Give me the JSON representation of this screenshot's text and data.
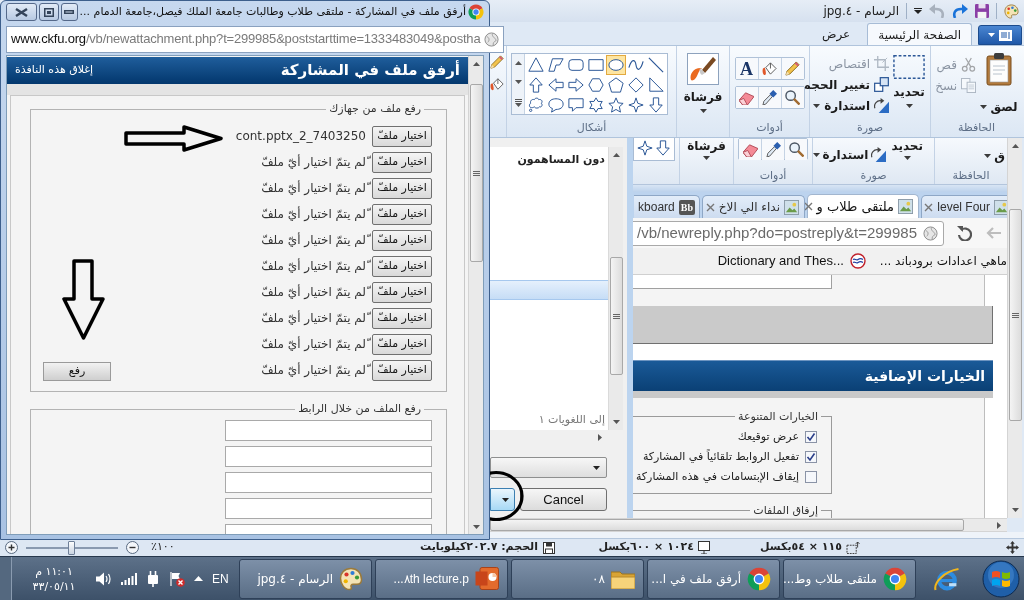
{
  "paint": {
    "title": "الرسام - ٤.jpg",
    "tabs": [
      {
        "label": "الصفحة الرئيسية",
        "selected": true
      },
      {
        "label": "عرض",
        "selected": false
      }
    ],
    "ribbon": {
      "clipboard": {
        "label": "الحافظة",
        "paste": "لصق",
        "commands": [
          {
            "label": "قص",
            "disabled": true
          },
          {
            "label": "نسخ",
            "disabled": true
          }
        ]
      },
      "image": {
        "label": "صورة",
        "select": "تحديد",
        "commands": [
          {
            "label": "اقتصاص",
            "disabled": true
          },
          {
            "label": "تغيير الحجم",
            "disabled": false
          },
          {
            "label": "استدارة",
            "disabled": false
          }
        ]
      },
      "tools": {
        "label": "أدوات",
        "text_tool": "A"
      },
      "brushes": {
        "button": "فرشاة"
      },
      "shapes": {
        "label": "أشكال",
        "items": [
          {
            "selected": false
          },
          {
            "selected": false
          },
          {
            "selected": true
          },
          {
            "selected": false
          },
          {
            "selected": false
          },
          {
            "selected": false
          },
          {
            "selected": false
          },
          {
            "selected": false
          },
          {
            "selected": false
          },
          {
            "selected": false
          },
          {
            "selected": false
          },
          {
            "selected": false
          },
          {
            "selected": false
          },
          {
            "selected": false
          },
          {
            "selected": false
          },
          {
            "selected": false
          },
          {
            "selected": false
          },
          {
            "selected": false
          },
          {
            "selected": false
          },
          {
            "selected": false
          },
          {
            "selected": false
          }
        ]
      }
    },
    "canvas": {
      "list": [
        {
          "text": "دون المساهمون",
          "selected": false,
          "dimmed": false
        },
        {
          "selected": true,
          "dimmed": false
        },
        {
          "text": "إلى اللغويات ١",
          "selected": false,
          "dimmed": true
        }
      ],
      "cancel_button": "Cancel",
      "browser": {
        "ribbon": {
          "paste": "ق",
          "clipboard_label": "الحافظة",
          "select": "تحديد",
          "rotate": "استدارة",
          "image_label": "صورة",
          "tools_label": "أدوات",
          "brushes": "فرشاة"
        },
        "tabs": [
          {
            "title": "level Four",
            "selected": false
          },
          {
            "title": "ملتقى طلاب و",
            "selected": true
          },
          {
            "title": "نداء الي الاخ",
            "selected": false
          },
          {
            "title": "kboard",
            "badge": "Bb",
            "selected": false
          }
        ],
        "url": "/vb/newreply.php?do=postreply&t=299985",
        "bookmarks": [
          {
            "title": "ماهي اعدادات برودباند ...",
            "icon": false
          },
          {
            "title": "Dictionary and Thes...",
            "icon": true
          }
        ],
        "section_title": "الخيارات الإضافية",
        "misc_options": {
          "legend": "الخيارات المتنوعة",
          "options": [
            {
              "label": "عرض توقيعك",
              "checked": true
            },
            {
              "label": "تفعيل الروابط تلقائياً في المشاركة",
              "checked": true
            },
            {
              "label": "إيقاف الإبتسامات في هذه المشاركة",
              "checked": false
            }
          ]
        },
        "attachments_legend": "إرفاق الملفات"
      }
    },
    "status_bar": {
      "selection_size": "١١٥ × ٥٤بكسل",
      "image_size": "١٠٢٤ × ٦٠٠بكسل",
      "file_size": "الحجم: ٢٠٢.٧كيلوبايت",
      "zoom": "١٠٠٪",
      "zoom_slider": {
        "level": 0.5
      }
    }
  },
  "popup": {
    "title": "أرفق ملف في المشاركة - ملتقى طلاب وطالبات جامعة الملك فيصل،جامعة الدمام ...",
    "url": {
      "host": "www.ckfu.org",
      "path": "/vb/newattachment.php?t=299985&poststarttime=1333483049&postha"
    },
    "header": "أرفق ملف في المشاركة",
    "close_link": "إغلاق هذه النافذة",
    "upload": {
      "legend": "رفع ملف من جهازك",
      "rows": [
        {
          "button": "اختيار ملفّ",
          "file": "cont.pptx_2_7403250"
        },
        {
          "button": "اختيار ملفّ",
          "file": "ّلم يتمّ اختيار أيّ ملفّ"
        },
        {
          "button": "اختيار ملفّ",
          "file": "ّلم يتمّ اختيار أيّ ملفّ"
        },
        {
          "button": "اختيار ملفّ",
          "file": "ّلم يتمّ اختيار أيّ ملفّ"
        },
        {
          "button": "اختيار ملفّ",
          "file": "ّلم يتمّ اختيار أيّ ملفّ"
        },
        {
          "button": "اختيار ملفّ",
          "file": "ّلم يتمّ اختيار أيّ ملفّ"
        },
        {
          "button": "اختيار ملفّ",
          "file": "ّلم يتمّ اختيار أيّ ملفّ"
        },
        {
          "button": "اختيار ملفّ",
          "file": "ّلم يتمّ اختيار أيّ ملفّ"
        },
        {
          "button": "اختيار ملفّ",
          "file": "ّلم يتمّ اختيار أيّ ملفّ"
        },
        {
          "button": "اختيار ملفّ",
          "file": "ّلم يتمّ اختيار أيّ ملفّ"
        }
      ],
      "button": "رفع"
    },
    "by_link": {
      "legend": "رفع الملف من خلال الرابط"
    }
  },
  "taskbar": {
    "buttons": [
      {
        "kind": "browser",
        "label": "ملتقى طلاب وط..."
      },
      {
        "kind": "browser",
        "label": "أرفق ملف في ا..."
      },
      {
        "kind": "folder",
        "label": "٠٨"
      },
      {
        "kind": "slides",
        "label": "٨th lecture.p..."
      },
      {
        "kind": "paint",
        "label": "الرسام - ٤.jpg"
      }
    ],
    "language": "EN",
    "time": "١١:٠١ م",
    "date": "٣٣/٠٥/١١"
  }
}
